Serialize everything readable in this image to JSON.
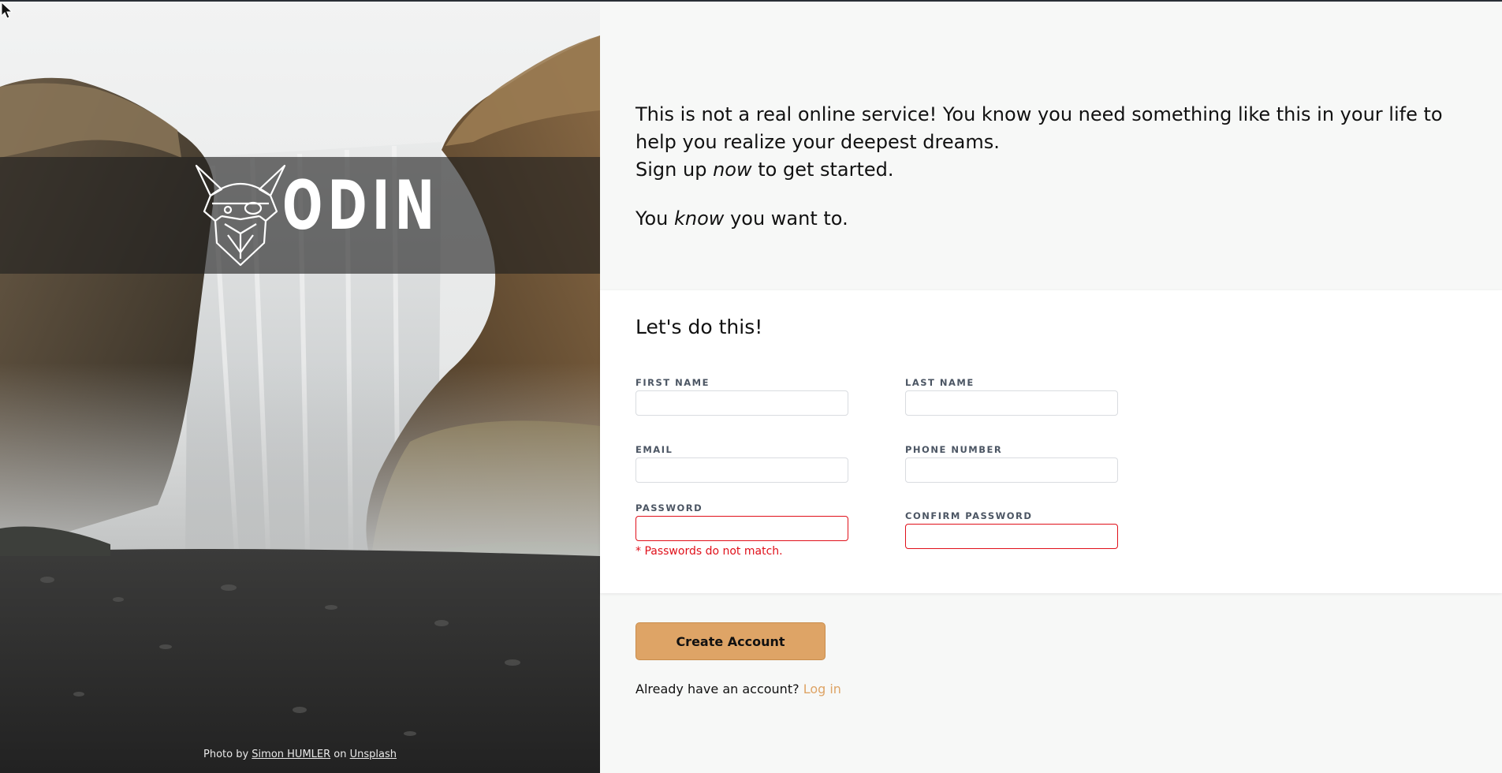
{
  "hero": {
    "logo_text": "ODIN",
    "credit": {
      "prefix": "Photo by",
      "author": "Simon HUMLER",
      "joiner": "on",
      "source": "Unsplash"
    }
  },
  "intro": {
    "line1": "This is not a real online service! You know you need something like this in your life to help you realize your deepest dreams.",
    "line2_before": "Sign up",
    "line2_em": "now",
    "line2_after": "to get started.",
    "line3_before": "You",
    "line3_em": "know",
    "line3_after": "you want to."
  },
  "form": {
    "title": "Let's do this!",
    "first_name_label": "First Name",
    "last_name_label": "Last Name",
    "email_label": "Email",
    "phone_label": "Phone Number",
    "password_label": "Password",
    "confirm_password_label": "Confirm Password",
    "first_name_value": "",
    "last_name_value": "",
    "email_value": "",
    "phone_value": "",
    "password_value": "",
    "confirm_password_value": "",
    "password_error": "* Passwords do not match."
  },
  "actions": {
    "create_label": "Create Account",
    "login_prompt": "Already have an account?",
    "login_link": "Log in"
  },
  "colors": {
    "accent": "#dea466",
    "error": "#e0101a",
    "page_bg": "#f7f8f7"
  }
}
